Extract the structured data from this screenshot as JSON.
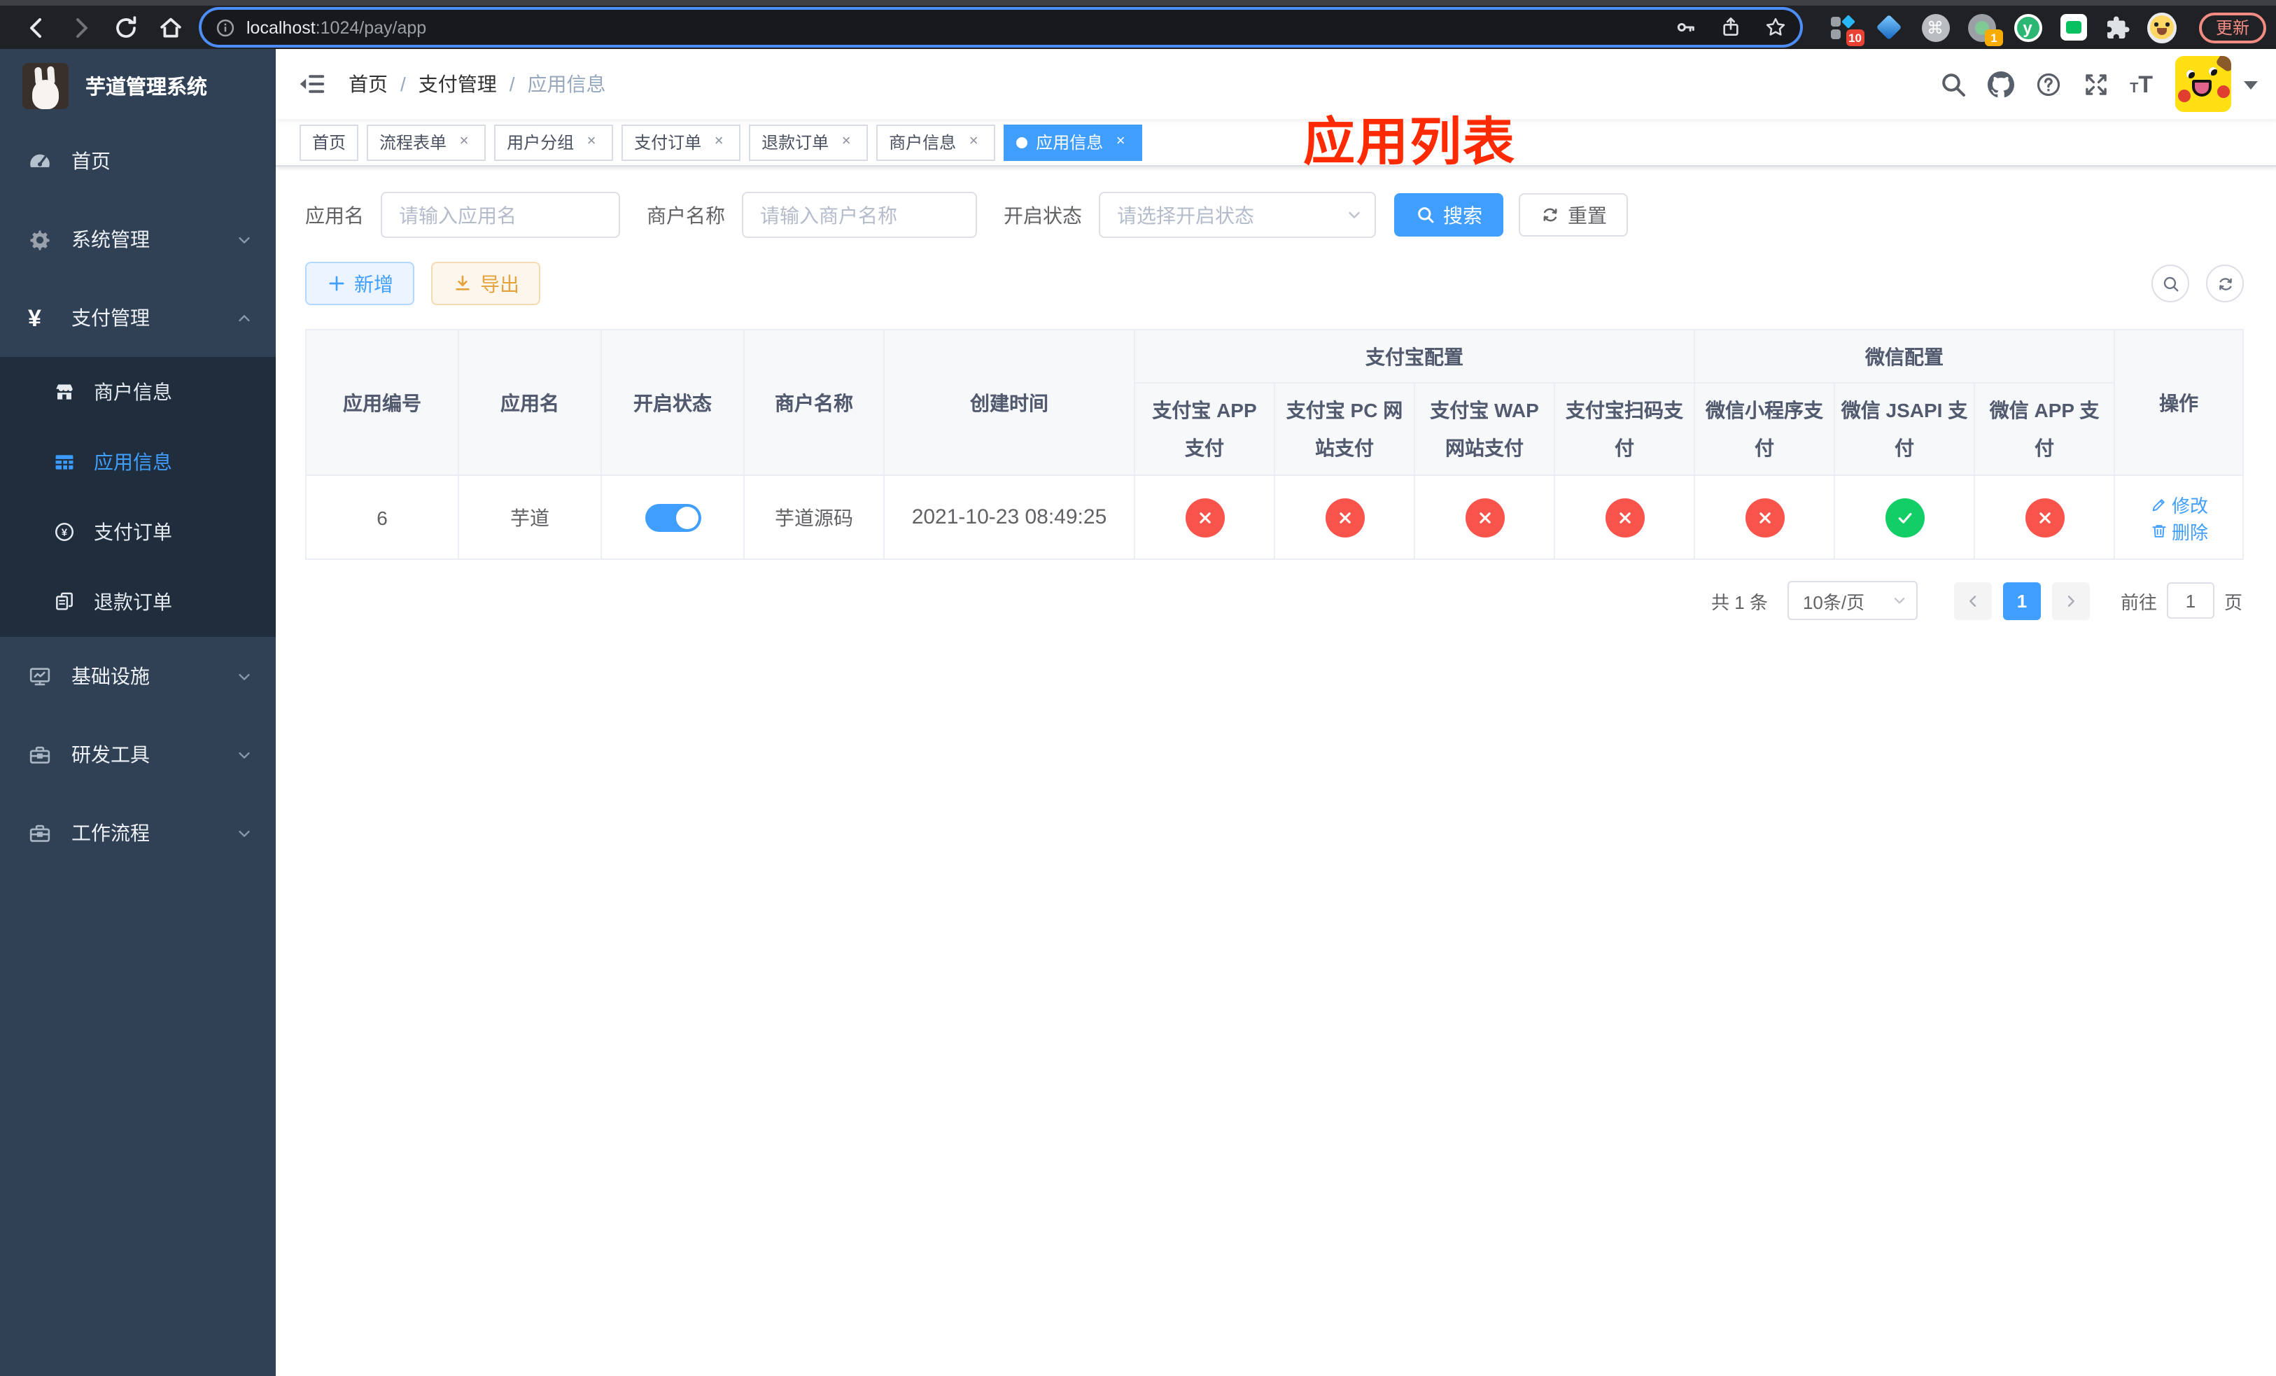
{
  "colors": {
    "accent": "#409eff",
    "success": "#13ce66",
    "danger": "#f8544b",
    "warning": "#e6a23c",
    "overlay_title": "#ff2a00",
    "sidebar_bg": "#304156",
    "submenu_bg": "#1f2d3d"
  },
  "browser": {
    "url_host": "localhost",
    "url_path": ":1024/pay/app",
    "ext_badge_10": "10",
    "ext_badge_1": "1",
    "ext_cmd_glyph": "⌘",
    "ext_y_label": "y",
    "update_label": "更新"
  },
  "sidebar": {
    "title": "芋道管理系统",
    "items": [
      {
        "label": "首页"
      },
      {
        "label": "系统管理"
      },
      {
        "label": "支付管理"
      },
      {
        "label": "基础设施"
      },
      {
        "label": "研发工具"
      },
      {
        "label": "工作流程"
      }
    ],
    "submenu": [
      {
        "label": "商户信息"
      },
      {
        "label": "应用信息"
      },
      {
        "label": "支付订单"
      },
      {
        "label": "退款订单"
      }
    ]
  },
  "navbar": {
    "breadcrumb": [
      "首页",
      "支付管理",
      "应用信息"
    ],
    "overlay_title": "应用列表"
  },
  "tabs": [
    {
      "label": "首页"
    },
    {
      "label": "流程表单"
    },
    {
      "label": "用户分组"
    },
    {
      "label": "支付订单"
    },
    {
      "label": "退款订单"
    },
    {
      "label": "商户信息"
    },
    {
      "label": "应用信息"
    }
  ],
  "filters": {
    "app_name_label": "应用名",
    "app_name_placeholder": "请输入应用名",
    "merchant_label": "商户名称",
    "merchant_placeholder": "请输入商户名称",
    "status_label": "开启状态",
    "status_placeholder": "请选择开启状态",
    "search_label": "搜索",
    "reset_label": "重置"
  },
  "toolbar": {
    "add_label": "新增",
    "export_label": "导出"
  },
  "table": {
    "headers": {
      "app_id": "应用编号",
      "app_name": "应用名",
      "status": "开启状态",
      "merchant": "商户名称",
      "created": "创建时间",
      "alipay_group": "支付宝配置",
      "wechat_group": "微信配置",
      "alipay_app": "支付宝 APP 支付",
      "alipay_pc": "支付宝 PC 网站支付",
      "alipay_wap": "支付宝 WAP 网站支付",
      "alipay_scan": "支付宝扫码支付",
      "wechat_lite": "微信小程序支付",
      "wechat_jsapi": "微信 JSAPI 支付",
      "wechat_app": "微信 APP 支付",
      "actions": "操作"
    },
    "rows": [
      {
        "app_id": "6",
        "app_name": "芋道",
        "enabled": true,
        "merchant": "芋道源码",
        "created": "2021-10-23 08:49:25",
        "alipay_app": "no",
        "alipay_pc": "no",
        "alipay_wap": "no",
        "alipay_scan": "no",
        "wechat_lite": "no",
        "wechat_jsapi": "yes",
        "wechat_app": "no",
        "edit_label": "修改",
        "delete_label": "删除"
      }
    ]
  },
  "pagination": {
    "total": "共 1 条",
    "page_size": "10条/页",
    "current_page": "1",
    "goto_label": "前往",
    "goto_value": "1",
    "page_unit": "页"
  }
}
